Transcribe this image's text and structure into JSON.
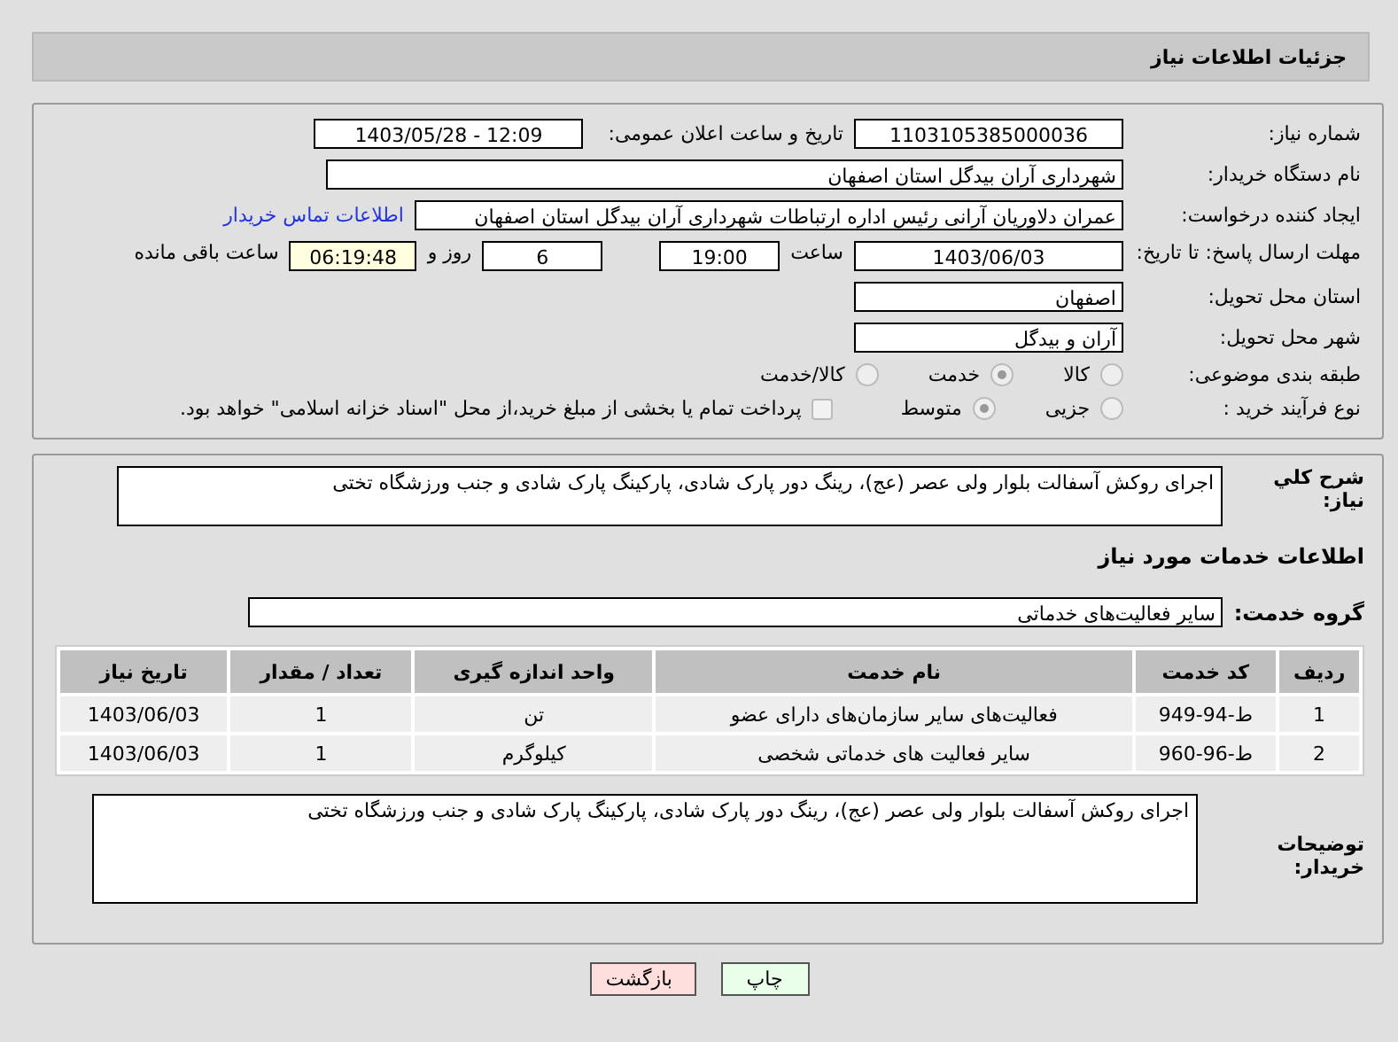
{
  "header": {
    "title": "جزئیات اطلاعات نیاز"
  },
  "need_number": {
    "label": "شماره نیاز:",
    "value": "1103105385000036"
  },
  "announce": {
    "label": "تاریخ و ساعت اعلان عمومی:",
    "value": "1403/05/28 - 12:09"
  },
  "buyer": {
    "label": "نام دستگاه خریدار:",
    "value": "شهرداری آران بیدگل استان اصفهان"
  },
  "creator": {
    "label": "ایجاد کننده درخواست:",
    "value": "عمران دلاوریان آرانی رئیس اداره ارتباطات شهرداری آران بیدگل استان اصفهان",
    "link": "اطلاعات تماس خریدار"
  },
  "deadline": {
    "label": "مهلت ارسال پاسخ: تا تاریخ:",
    "date": "1403/06/03",
    "time_label": "ساعت",
    "time": "19:00",
    "days": "6",
    "days_label": "روز و",
    "remaining": "06:19:48",
    "remaining_label": "ساعت باقی مانده"
  },
  "province": {
    "label": "استان محل تحویل:",
    "value": "اصفهان"
  },
  "city": {
    "label": "شهر محل تحویل:",
    "value": "آران و بیدگل"
  },
  "category": {
    "label": "طبقه بندی موضوعی:",
    "options": [
      {
        "label": "کالا",
        "selected": false
      },
      {
        "label": "خدمت",
        "selected": true
      },
      {
        "label": "کالا/خدمت",
        "selected": false
      }
    ]
  },
  "process": {
    "label": "نوع فرآیند خرید :",
    "options": [
      {
        "label": "جزیی",
        "selected": false
      },
      {
        "label": "متوسط",
        "selected": true
      }
    ],
    "payment": {
      "checked": false,
      "label": "پرداخت تمام یا بخشی از مبلغ خرید،از محل \"اسناد خزانه اسلامی\" خواهد بود."
    }
  },
  "summary": {
    "label": "شرح کلي نياز:",
    "value": "اجرای روکش آسفالت بلوار ولی عصر (عج)، رینگ دور پارک شادی، پارکینگ پارک شادی و جنب ورزشگاه تختی"
  },
  "services_title": "اطلاعات خدمات مورد نیاز",
  "service_group": {
    "label": "گروه خدمت:",
    "value": "سایر فعالیت‌های خدماتی"
  },
  "table": {
    "columns": [
      "ردیف",
      "کد خدمت",
      "نام خدمت",
      "واحد اندازه گیری",
      "تعداد / مقدار",
      "تاریخ نیاز"
    ],
    "rows": [
      [
        "1",
        "ط-94-949",
        "فعالیت‌های سایر سازمان‌های دارای عضو",
        "تن",
        "1",
        "1403/06/03"
      ],
      [
        "2",
        "ط-96-960",
        "سایر فعالیت های خدماتی شخصی",
        "کیلوگرم",
        "1",
        "1403/06/03"
      ]
    ]
  },
  "buyer_notes": {
    "label": "توضیحات خریدار:",
    "value": "اجرای روکش آسفالت بلوار ولی عصر (عج)، رینگ دور پارک شادی، پارکینگ پارک شادی و جنب ورزشگاه تختی"
  },
  "buttons": [
    {
      "label": "چاپ",
      "kind": "print"
    },
    {
      "label": "بازگشت",
      "kind": "back"
    }
  ]
}
